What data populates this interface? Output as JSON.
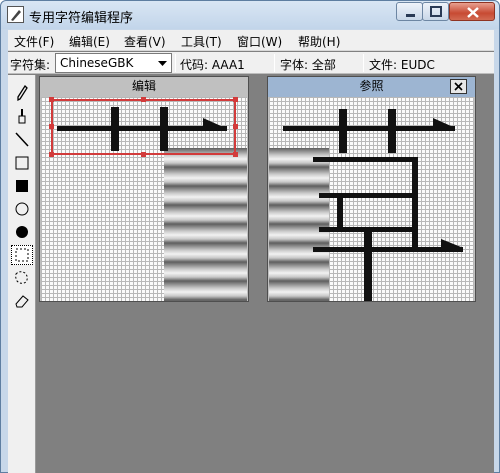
{
  "window": {
    "title": "专用字符编辑程序"
  },
  "menu": [
    {
      "label": "文件(F)"
    },
    {
      "label": "编辑(E)"
    },
    {
      "label": "查看(V)"
    },
    {
      "label": "工具(T)"
    },
    {
      "label": "窗口(W)"
    },
    {
      "label": "帮助(H)"
    }
  ],
  "toolbar": {
    "charset_label": "字符集:",
    "charset_value": "ChineseGBK",
    "code_label": "代码: AAA1",
    "font_label": "字体: 全部",
    "file_label": "文件: EUDC"
  },
  "tools": [
    {
      "icon": "pencil-icon"
    },
    {
      "icon": "brush-icon"
    },
    {
      "icon": "line-icon"
    },
    {
      "icon": "hollow-rectangle-icon"
    },
    {
      "icon": "filled-rectangle-icon"
    },
    {
      "icon": "hollow-ellipse-icon"
    },
    {
      "icon": "filled-ellipse-icon"
    },
    {
      "icon": "rectangle-select-icon",
      "selected": true
    },
    {
      "icon": "freeform-select-icon"
    },
    {
      "icon": "eraser-icon"
    }
  ],
  "edit_pane": {
    "title": "编辑"
  },
  "reference_pane": {
    "title": "参照",
    "close_icon": "close-icon"
  },
  "colors": {
    "selection": "#d23b3b",
    "pane_header_active": "#9db5d2",
    "pixel": "#111111"
  }
}
